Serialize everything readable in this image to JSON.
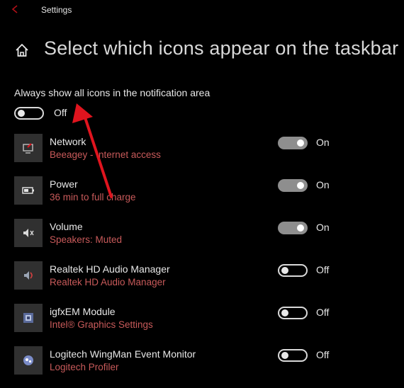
{
  "window": {
    "title": "Settings"
  },
  "header": {
    "title": "Select which icons appear on the taskbar"
  },
  "master": {
    "label": "Always show all icons in the notification area",
    "state": "Off"
  },
  "items": [
    {
      "name": "Network",
      "sub": "Beeagey - Internet access",
      "state": "On",
      "icon": "network-icon"
    },
    {
      "name": "Power",
      "sub": "36 min to full charge",
      "state": "On",
      "icon": "battery-icon"
    },
    {
      "name": "Volume",
      "sub": "Speakers: Muted",
      "state": "On",
      "icon": "speaker-icon"
    },
    {
      "name": "Realtek HD Audio Manager",
      "sub": "Realtek HD Audio Manager",
      "state": "Off",
      "icon": "audio-manager-icon"
    },
    {
      "name": "igfxEM Module",
      "sub": "Intel® Graphics Settings",
      "state": "Off",
      "icon": "intel-graphics-icon"
    },
    {
      "name": "Logitech WingMan Event Monitor",
      "sub": "Logitech Profiler",
      "state": "Off",
      "icon": "logitech-icon"
    }
  ],
  "colors": {
    "background": "#000000",
    "accent_red": "#e0141e",
    "subtitle": "#c85a5a",
    "toggle_on": "#8e8e8e"
  }
}
